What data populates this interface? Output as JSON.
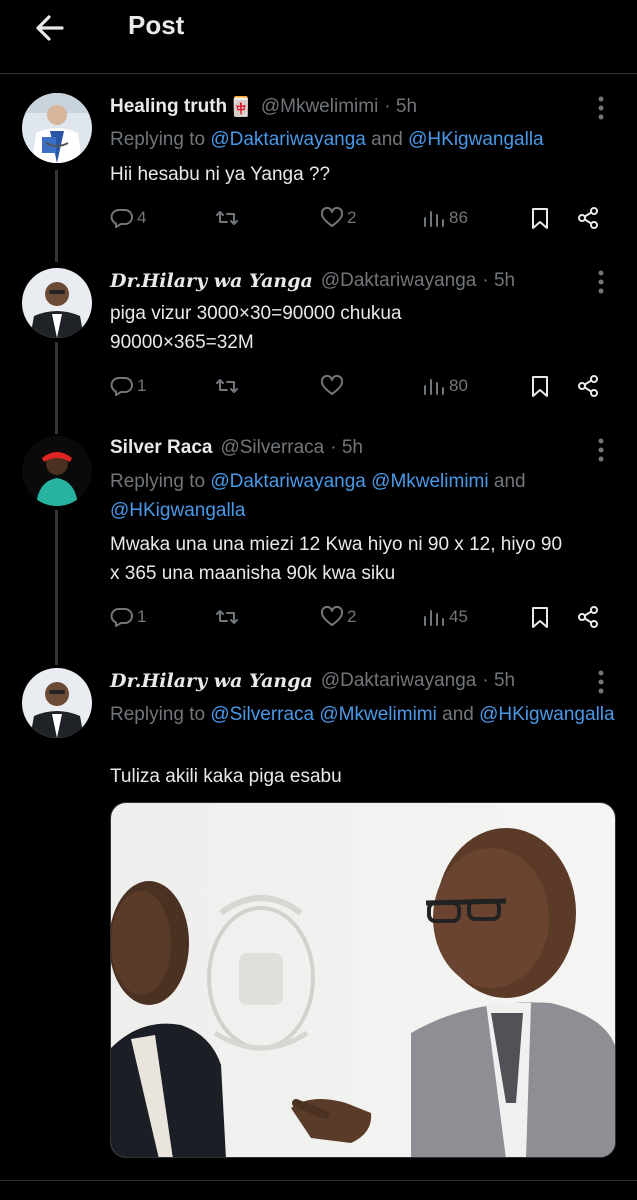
{
  "header": {
    "title": "Post"
  },
  "tweets": [
    {
      "name": "Healing truth",
      "name_emoji": "🀄",
      "handle": "@Mkwelimimi",
      "time": "5h",
      "replying_prefix": "Replying to ",
      "mentions": [
        "@Daktariwayanga",
        "@HKigwangalla"
      ],
      "joiner": " and ",
      "text": "Hii hesabu ni ya Yanga ??",
      "replies": "4",
      "retweets": "",
      "likes": "2",
      "views": "86"
    },
    {
      "name": "Dr.Hilary wa Yanga",
      "handle": "@Daktariwayanga",
      "time": "5h",
      "text_line1": "piga vizur 3000×30=90000 chukua",
      "text_line2": "90000×365=32M",
      "replies": "1",
      "retweets": "",
      "likes": "",
      "views": "80"
    },
    {
      "name": "Silver Raca",
      "handle": "@Silverraca",
      "time": "5h",
      "replying_prefix": "Replying to ",
      "mentions": [
        "@Daktariwayanga",
        "@Mkwelimimi",
        "@HKigwangalla"
      ],
      "joiner": " and ",
      "text_line1": "Mwaka una una miezi 12 Kwa hiyo ni 90 x 12, hiyo 90",
      "text_line2": "x 365 una maanisha 90k kwa siku",
      "replies": "1",
      "retweets": "",
      "likes": "2",
      "views": "45"
    },
    {
      "name": "Dr.Hilary wa Yanga",
      "handle": "@Daktariwayanga",
      "time": "5h",
      "replying_prefix": "Replying to ",
      "mentions": [
        "@Silverraca",
        "@Mkwelimimi",
        "@HKigwangalla"
      ],
      "joiner": " and ",
      "text": "Tuliza akili kaka piga esabu"
    }
  ],
  "colors": {
    "background": "#000000",
    "text": "#e7e9ea",
    "muted": "#71767b",
    "link": "#4a99e9",
    "divider": "#2f3336"
  }
}
